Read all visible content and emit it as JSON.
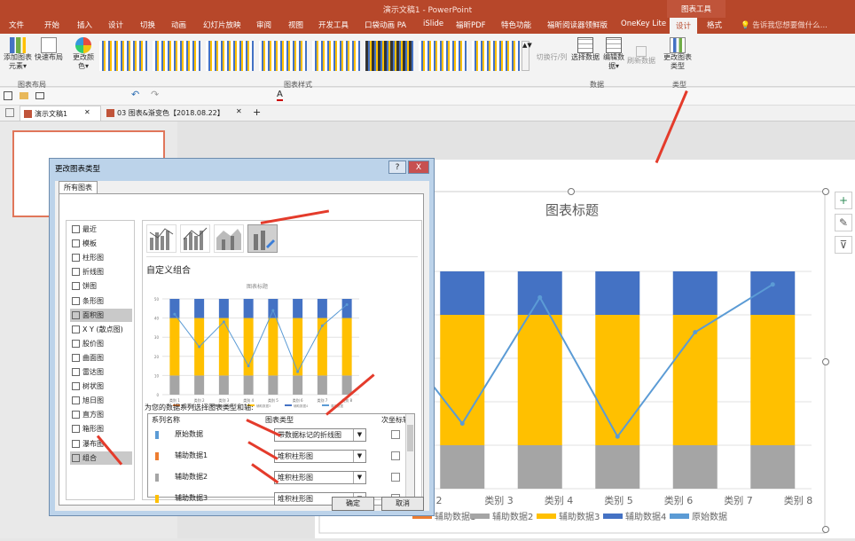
{
  "window": {
    "title": "演示文稿1 - PowerPoint",
    "context_tab_group": "图表工具"
  },
  "tabs": [
    "文件",
    "开始",
    "插入",
    "设计",
    "切换",
    "动画",
    "幻灯片放映",
    "审阅",
    "视图",
    "开发工具",
    "口袋动画 PA",
    "iSlide",
    "福昕PDF",
    "特色功能",
    "福昕阅读器领鲜版",
    "OneKey Lite",
    "设计",
    "格式"
  ],
  "tell_me": "告诉我您想要做什么...",
  "ribbon": {
    "add_element": "添加图表元素▾",
    "quick_layout": "快速布局",
    "change_color": "更改颜色▾",
    "switch_rowcol": "切换行/列",
    "select_data": "选择数据",
    "edit_data": "编辑数据▾",
    "refresh_data": "刷新数据",
    "change_type": "更改图表类型",
    "group_layout": "图表布局",
    "group_styles": "图表样式",
    "group_data": "数据",
    "group_type": "类型"
  },
  "doc_tabs": [
    "演示文稿1",
    "03 图表&渐变色【2018.08.22】"
  ],
  "dialog": {
    "title": "更改图表类型",
    "help": "?",
    "close": "X",
    "tab": "所有图表",
    "categories": [
      "最近",
      "模板",
      "柱形图",
      "折线图",
      "饼图",
      "条形图",
      "面积图",
      "X Y (散点图)",
      "股价图",
      "曲面图",
      "雷达图",
      "树状图",
      "旭日图",
      "直方图",
      "箱形图",
      "瀑布图",
      "组合"
    ],
    "combo_heading": "自定义组合",
    "preview_title": "图表标题",
    "series_prompt": "为您的数据系列选择图表类型和轴:",
    "col_name": "系列名称",
    "col_type": "图表类型",
    "col_axis": "次坐标轴",
    "series": [
      {
        "name": "原始数据",
        "type": "带数据标记的折线图",
        "color": "#5b9bd5"
      },
      {
        "name": "辅助数据1",
        "type": "堆积柱形图",
        "color": "#ed7d31"
      },
      {
        "name": "辅助数据2",
        "type": "堆积柱形图",
        "color": "#a5a5a5"
      },
      {
        "name": "辅助数据3",
        "type": "堆积柱形图",
        "color": "#ffc000"
      }
    ],
    "ok": "确定",
    "cancel": "取消"
  },
  "chart_data": {
    "type": "bar",
    "title": "图表标题",
    "categories": [
      "类别 1",
      "类别 2",
      "类别 3",
      "类别 4",
      "类别 5",
      "类别 6",
      "类别 7",
      "类别 8"
    ],
    "series": [
      {
        "name": "辅助数据1",
        "kind": "stacked-bar",
        "color": "#ed7d31",
        "values": [
          0,
          0,
          0,
          0,
          0,
          0,
          0,
          0
        ]
      },
      {
        "name": "辅助数据2",
        "kind": "stacked-bar",
        "color": "#a5a5a5",
        "values": [
          10,
          10,
          10,
          10,
          10,
          10,
          10,
          10
        ]
      },
      {
        "name": "辅助数据3",
        "kind": "stacked-bar",
        "color": "#ffc000",
        "values": [
          30,
          30,
          30,
          30,
          30,
          30,
          30,
          30
        ]
      },
      {
        "name": "辅助数据4",
        "kind": "stacked-bar",
        "color": "#4472c4",
        "values": [
          10,
          10,
          10,
          10,
          10,
          10,
          10,
          10
        ]
      },
      {
        "name": "原始数据",
        "kind": "line",
        "color": "#5b9bd5",
        "values": [
          42,
          25,
          38,
          15,
          44,
          12,
          36,
          47
        ]
      }
    ],
    "legend_position": "bottom",
    "ylim": [
      0,
      50
    ],
    "visible_main_categories": [
      "2",
      "类别 3",
      "类别 4",
      "类别 5",
      "类别 6",
      "类别 7",
      "类别 8"
    ]
  }
}
